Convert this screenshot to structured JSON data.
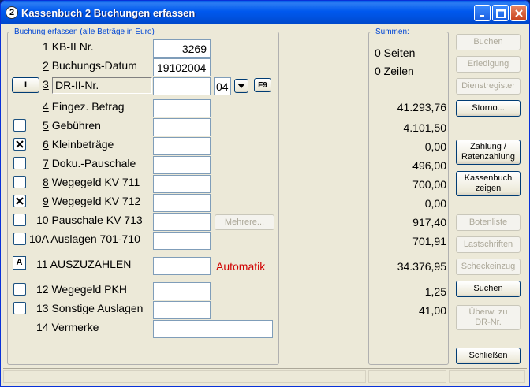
{
  "window": {
    "icon_label": "2",
    "title": "Kassenbuch 2 Buchungen erfassen"
  },
  "entry_group": {
    "label": "Buchung erfassen (alle Beträge in Euro)"
  },
  "summary_group": {
    "label": "Summen:",
    "pages": "0 Seiten",
    "lines": "0 Zeilen"
  },
  "fields": {
    "kb_nr": {
      "num": "1",
      "label": "KB-II Nr.",
      "value": "3269"
    },
    "datum": {
      "num": "2",
      "label": "Buchungs-Datum",
      "value": "19102004"
    },
    "dr_nr": {
      "btn": "I",
      "num": "3",
      "label": "DR-II-Nr.",
      "value": "",
      "suffix": "04",
      "f9": "F9"
    },
    "eingez": {
      "num": "4",
      "label": "Eingez. Betrag",
      "value": "",
      "sum": "41.293,76"
    },
    "gebuehren": {
      "num": "5",
      "label": "Gebühren",
      "value": "",
      "sum": "4.101,50",
      "checked": false
    },
    "klein": {
      "num": "6",
      "label": "Kleinbeträge",
      "value": "",
      "sum": "0,00",
      "checked": true
    },
    "doku": {
      "num": "7",
      "label": "Doku.-Pauschale",
      "value": "",
      "sum": "496,00",
      "checked": false
    },
    "weg711": {
      "num": "8",
      "label": "Wegegeld KV 711",
      "value": "",
      "sum": "700,00",
      "checked": false
    },
    "weg712": {
      "num": "9",
      "label": "Wegegeld KV 712",
      "value": "",
      "sum": "0,00",
      "checked": true
    },
    "pausch713": {
      "num": "10",
      "label": "Pauschale KV 713",
      "value": "",
      "sum": "917,40",
      "checked": false,
      "more": "Mehrere..."
    },
    "auslagen": {
      "num": "10A",
      "label": "Auslagen 701-710",
      "value": "",
      "sum": "701,91",
      "checked": false
    },
    "auszahlen": {
      "btn": "A",
      "num": "11",
      "label": "AUSZUZAHLEN",
      "value": "",
      "sum": "34.376,95",
      "note": "Automatik"
    },
    "pkh": {
      "num": "12",
      "label": "Wegegeld PKH",
      "value": "",
      "sum": "1,25",
      "checked": false
    },
    "sonst": {
      "num": "13",
      "label": "Sonstige Auslagen",
      "value": "",
      "sum": "41,00",
      "checked": false
    },
    "vermerke": {
      "num": "14",
      "label": "Vermerke",
      "value": ""
    }
  },
  "buttons": {
    "buchen": "Buchen",
    "erledigung": "Erledigung",
    "dienstregister": "Dienstregister",
    "storno": "Storno...",
    "zahlung_1": "Zahlung /",
    "zahlung_2": "Ratenzahlung",
    "kassenbuch_1": "Kassenbuch",
    "kassenbuch_2": "zeigen",
    "botenliste": "Botenliste",
    "lastschriften": "Lastschriften",
    "scheckeinzug": "Scheckeinzug",
    "suchen": "Suchen",
    "ueberw_1": "Überw. zu",
    "ueberw_2": "DR-Nr.",
    "schliessen": "Schließen"
  },
  "icons": {
    "app": "app-icon",
    "minimize": "minimize-icon",
    "maximize": "maximize-icon",
    "close": "close-icon",
    "checkmark": "x-check-icon",
    "dropdown": "triangle-down-icon"
  }
}
